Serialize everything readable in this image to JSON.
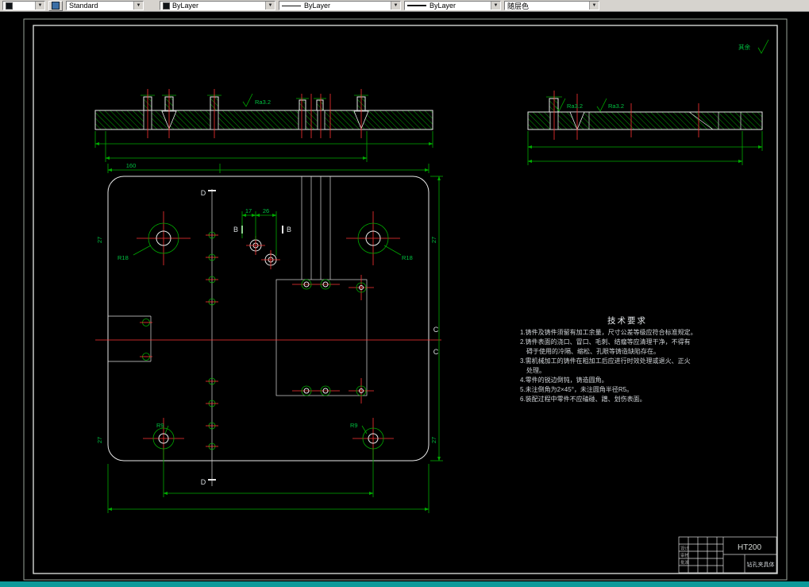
{
  "colors": {
    "object_line": "#e8e8e8",
    "dimension_green": "#00aa00",
    "centerline_red": "#ff3434",
    "hatch_green": "#00a000",
    "toolbar_bg": "#d6d3ce",
    "status_bar": "#0c9a9a",
    "canvas": "#000000"
  },
  "toolbar": {
    "style_combo": {
      "value": "Standard"
    },
    "color_combo": {
      "value": "ByLayer"
    },
    "linetype_combo": {
      "value": "ByLayer"
    },
    "lineweight_combo": {
      "value": "ByLayer"
    },
    "plotstyle_combo": {
      "value": "随层色"
    }
  },
  "annotations": {
    "surface_finish": "Ra3.2",
    "rest_label": "其余",
    "dim_160": "160",
    "dim_17": "17",
    "dim_26": "26",
    "dim_27": "27",
    "radius_big": "R18",
    "radius_small": "R9",
    "section_b": "B",
    "section_c": "C",
    "section_d": "D"
  },
  "tech_requirements": {
    "title": "技术要求",
    "lines": [
      "1.铸件及铸件须留有加工余量，尺寸公差等级应符合标准规定。",
      "2.铸件表面的浇口、冒口、毛刺、结瘤等应清理干净，不得有",
      "碍于使用的冷隔、缩松、孔眼等铸造缺陷存在。",
      "3.需机械加工的铸件在粗加工后应进行时效处理或退火、正火",
      "处理。",
      "4.零件的锐边倒钝，铸造圆角。",
      "5.未注倒角为2×45°，未注圆角半径R5。",
      "6.装配过程中零件不应磕碰、蹭、划伤表面。"
    ]
  },
  "title_block": {
    "material": "HT200",
    "part_name": "钻孔夹具体",
    "row_labels": [
      "设计",
      "审核",
      "批准"
    ]
  }
}
